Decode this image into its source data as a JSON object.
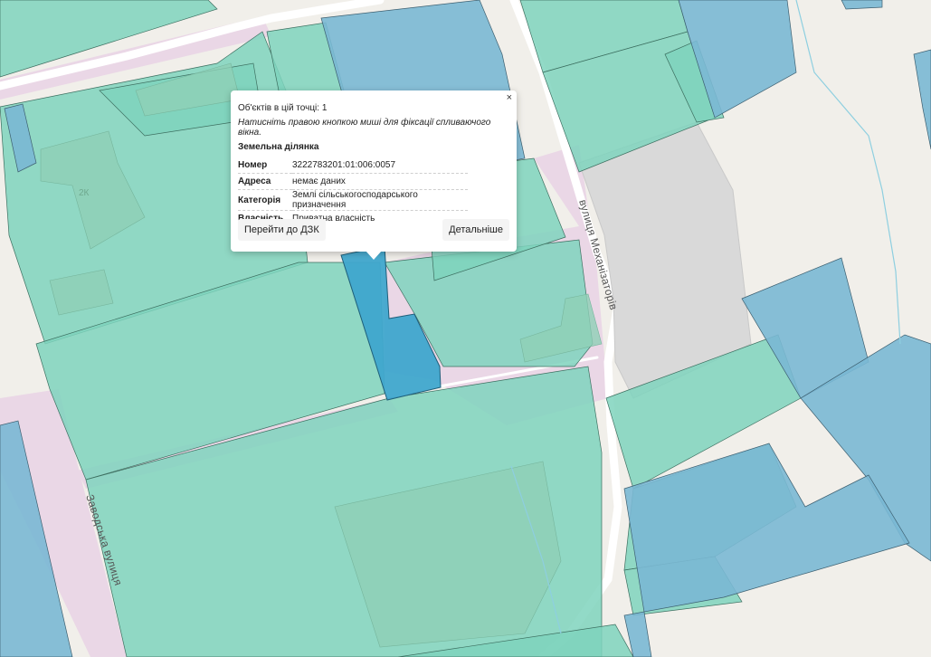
{
  "map": {
    "streets": {
      "mekhanizatoriv": "вулиця Механізаторів",
      "zavodska": "Заводська вулиця"
    },
    "building_label": "2К",
    "colors": {
      "background": "#f1efea",
      "road_pink": "#ead7e6",
      "parcel_green": "#7fd4bd",
      "parcel_blue": "#7ab8d4",
      "parcel_gray": "#d5d5d5",
      "selected_parcel": "#3fa6cd"
    }
  },
  "popup": {
    "objects_count": "Об'єктів в цій точці: 1",
    "hint": "Натисніть правою кнопкою миші для фіксації спливаючого вікна.",
    "section_title": "Земельна ділянка",
    "rows": [
      {
        "key": "Номер",
        "value": "3222783201:01:006:0057"
      },
      {
        "key": "Адреса",
        "value": "немає даних"
      },
      {
        "key": "Категорія",
        "value": "Землі сільськогосподарського призначення"
      },
      {
        "key": "Власність",
        "value": "Приватна власність"
      }
    ],
    "close_label": "×",
    "btn_dzk": "Перейти до ДЗК",
    "btn_more": "Детальніше"
  }
}
